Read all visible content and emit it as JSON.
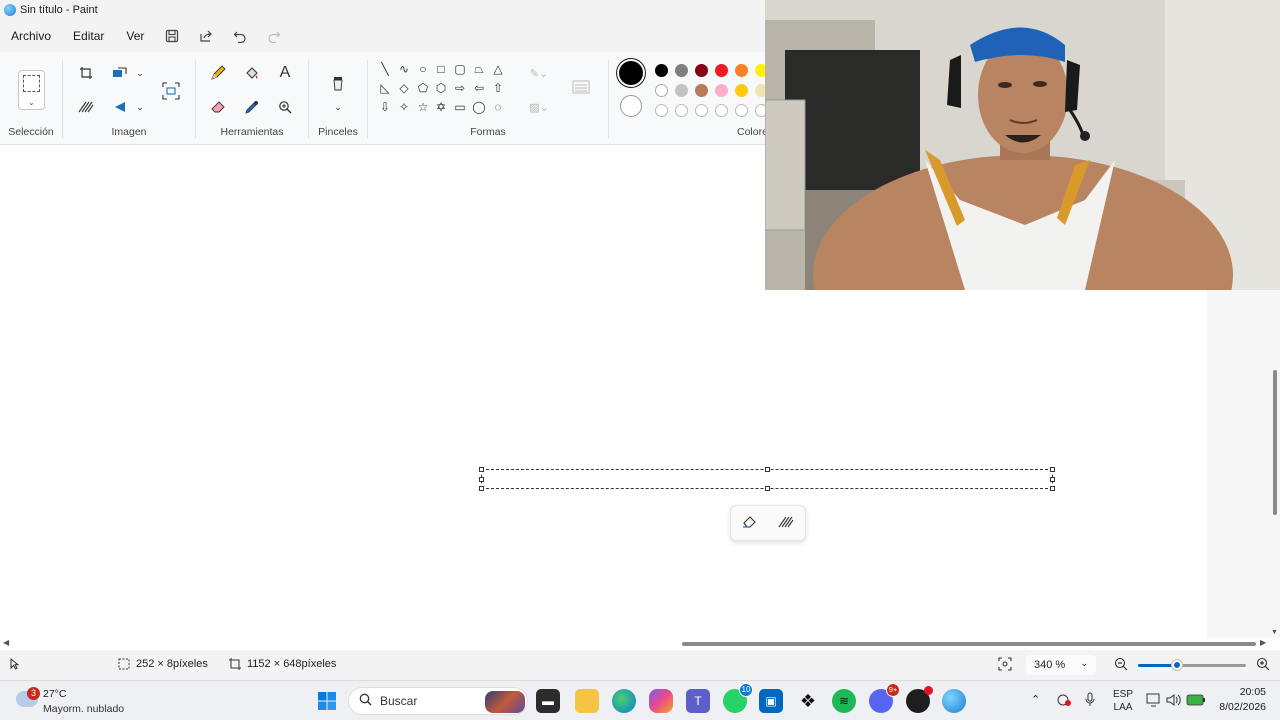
{
  "window": {
    "title": "Sin título - Paint"
  },
  "menu": {
    "items": [
      "Archivo",
      "Editar",
      "Ver"
    ],
    "icons": [
      "save-icon",
      "share-icon",
      "undo-icon",
      "redo-icon"
    ]
  },
  "ribbon": {
    "groups": {
      "seleccion": "Selección",
      "imagen": "Imagen",
      "herramientas": "Herramientas",
      "pinceles": "Pinceles",
      "formas": "Formas",
      "colores": "Colores"
    },
    "text_tool_glyph": "A"
  },
  "colors": {
    "primary": "#000000",
    "secondary": "#ffffff",
    "palette_row1": [
      "#000000",
      "#7f7f7f",
      "#880015",
      "#ed1c24",
      "#ff7f27",
      "#fff200"
    ],
    "palette_row2": [
      "#ffffff",
      "#c3c3c3",
      "#b97a57",
      "#ffaec9",
      "#ffc90e",
      "#efe4b0"
    ]
  },
  "status": {
    "selection_size": "252 × 8píxeles",
    "canvas_size": "1152 × 648píxeles",
    "zoom": "340 %",
    "zoom_fraction": 0.36
  },
  "taskbar": {
    "weather": {
      "badge": "3",
      "temp": "27°C",
      "desc": "Mayorm. nublado"
    },
    "search_placeholder": "Buscar",
    "whatsapp_badge": "10",
    "discord_badge": "9+",
    "language": {
      "lang": "ESP",
      "layout": "LAA"
    },
    "time": "20:05",
    "date": "8/02/2026"
  }
}
